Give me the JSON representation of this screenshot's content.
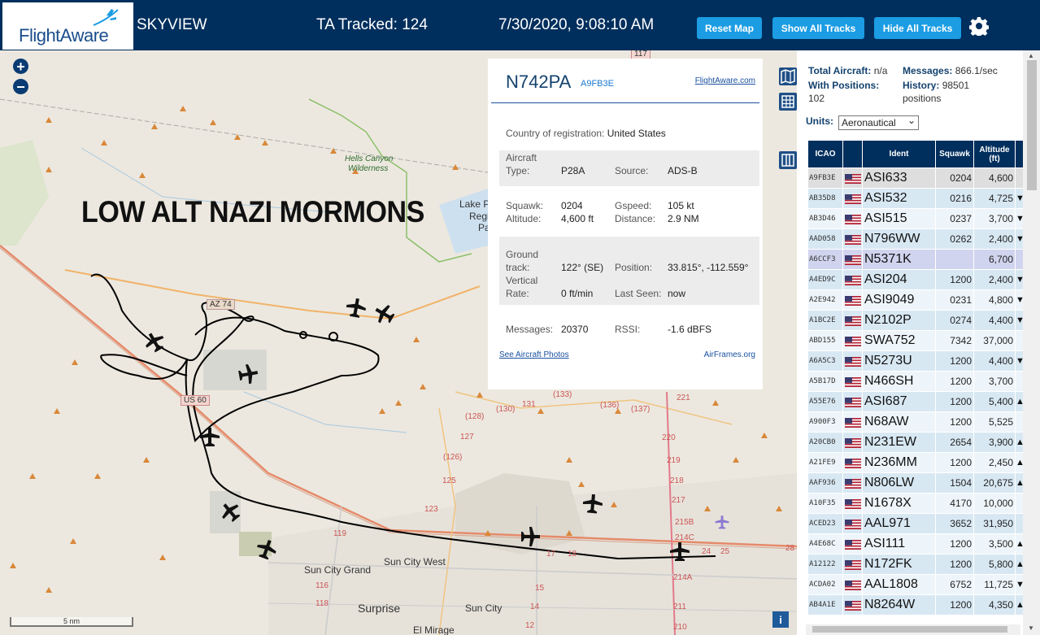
{
  "header": {
    "logo_text": "FlightAware",
    "app_title": "SKYVIEW",
    "ta_tracked": "TA Tracked: 124",
    "clock": "7/30/2020, 9:08:10 AM",
    "reset_map": "Reset Map",
    "show_all_tracks": "Show All Tracks",
    "hide_all_tracks": "Hide All Tracks",
    "settings_icon": "gear-icon",
    "brand_color": "#002f5d",
    "button_color": "#1b9ce3"
  },
  "map": {
    "zoom_in": "+",
    "zoom_out": "−",
    "overlay_text": "LOW ALT NAZI MORMONS",
    "scale": "5 nm",
    "info": "i",
    "labels": {
      "hells_canyon": "Hells Canyon",
      "wilderness": "Wilderness",
      "lake_p": "Lake P",
      "regi": "Regi",
      "pa": "Pa",
      "az74": "AZ 74",
      "us60": "US 60",
      "sun_city_grand": "Sun City Grand",
      "sun_city_west": "Sun City West",
      "sun_city": "Sun City",
      "surprise": "Surprise",
      "el_mirage": "El Mirage",
      "n117": "117",
      "n119": "119",
      "n116": "116",
      "n118": "118",
      "n123": "123",
      "n125": "125",
      "n126": "(126)",
      "n127": "127",
      "n128": "(128)",
      "n130": "(130)",
      "n131": "131",
      "n133": "(133)",
      "n136": "(136)",
      "n137": "(137)",
      "n220": "220",
      "n219": "219",
      "n218": "218",
      "n217": "217",
      "n215b": "215B",
      "n214c": "214C",
      "n214a": "214A",
      "n211": "211",
      "n210": "210",
      "n221": "221",
      "n24": "24",
      "n25": "25",
      "n28": "28",
      "n18": "18",
      "n14": "14",
      "n12": "12",
      "n17": "17",
      "n15": "15"
    }
  },
  "popup": {
    "callsign": "N742PA",
    "hex": "A9FB3E",
    "fa_link": "FlightAware.com",
    "country_label": "Country of registration:",
    "country_value": "United States",
    "aircraft_label": "Aircraft",
    "type_label": "Type:",
    "type_value": "P28A",
    "source_label": "Source:",
    "source_value": "ADS-B",
    "squawk_label": "Squawk:",
    "squawk_value": "0204",
    "gspeed_label": "Gspeed:",
    "gspeed_value": "105 kt",
    "altitude_label": "Altitude:",
    "altitude_value": "4,600 ft",
    "distance_label": "Distance:",
    "distance_value": "2.9 NM",
    "ground_label": "Ground",
    "track_label": "track:",
    "track_value": "122° (SE)",
    "position_label": "Position:",
    "position_value": "33.815°, -112.559°",
    "vertical_label": "Vertical",
    "rate_label": "Rate:",
    "rate_value": "0 ft/min",
    "lastseen_label": "Last Seen:",
    "lastseen_value": "now",
    "messages_label": "Messages:",
    "messages_value": "20370",
    "rssi_label": "RSSI:",
    "rssi_value": "-1.6 dBFS",
    "photos_link": "See Aircraft Photos",
    "airframes_link": "AirFrames.org"
  },
  "sidebar": {
    "total_label": "Total Aircraft:",
    "total_value": "n/a",
    "messages_label": "Messages:",
    "messages_value": "866.1/sec",
    "withpos_label": "With Positions:",
    "withpos_value": "102",
    "history_label": "History:",
    "history_value": "98501",
    "history_unit": "positions",
    "units_label": "Units:",
    "units_value": "Aeronautical",
    "columns": {
      "icao": "ICAO",
      "ident": "Ident",
      "squawk": "Squawk",
      "altitude": "Altitude (ft)"
    },
    "rows": [
      {
        "icao": "A9FB3E",
        "ident": "ASI633",
        "squawk": "0204",
        "alt": "4,600",
        "trend": ""
      },
      {
        "icao": "AB35D8",
        "ident": "ASI532",
        "squawk": "0216",
        "alt": "4,725",
        "trend": "▼"
      },
      {
        "icao": "AB3D46",
        "ident": "ASI515",
        "squawk": "0237",
        "alt": "3,700",
        "trend": "▼"
      },
      {
        "icao": "AAD058",
        "ident": "N796WW",
        "squawk": "0262",
        "alt": "2,400",
        "trend": "▼"
      },
      {
        "icao": "A6CCF3",
        "ident": "N5371K",
        "squawk": "",
        "alt": "6,700",
        "trend": ""
      },
      {
        "icao": "A4ED9C",
        "ident": "ASI204",
        "squawk": "1200",
        "alt": "2,400",
        "trend": "▼"
      },
      {
        "icao": "A2E942",
        "ident": "ASI9049",
        "squawk": "0231",
        "alt": "4,800",
        "trend": "▼"
      },
      {
        "icao": "A1BC2E",
        "ident": "N2102P",
        "squawk": "0274",
        "alt": "4,400",
        "trend": "▼"
      },
      {
        "icao": "ABD155",
        "ident": "SWA752",
        "squawk": "7342",
        "alt": "37,000",
        "trend": ""
      },
      {
        "icao": "A6A5C3",
        "ident": "N5273U",
        "squawk": "1200",
        "alt": "4,400",
        "trend": "▼"
      },
      {
        "icao": "A5B17D",
        "ident": "N466SH",
        "squawk": "1200",
        "alt": "3,700",
        "trend": ""
      },
      {
        "icao": "A55E76",
        "ident": "ASI687",
        "squawk": "1200",
        "alt": "5,400",
        "trend": "▲"
      },
      {
        "icao": "A900F3",
        "ident": "N68AW",
        "squawk": "1200",
        "alt": "5,525",
        "trend": ""
      },
      {
        "icao": "A20CB0",
        "ident": "N231EW",
        "squawk": "2654",
        "alt": "3,900",
        "trend": "▲"
      },
      {
        "icao": "A21FE9",
        "ident": "N236MM",
        "squawk": "1200",
        "alt": "2,450",
        "trend": "▲"
      },
      {
        "icao": "AAF936",
        "ident": "N806LW",
        "squawk": "1504",
        "alt": "20,675",
        "trend": "▲"
      },
      {
        "icao": "A10F35",
        "ident": "N1678X",
        "squawk": "4170",
        "alt": "10,000",
        "trend": ""
      },
      {
        "icao": "ACED23",
        "ident": "AAL971",
        "squawk": "3652",
        "alt": "31,950",
        "trend": ""
      },
      {
        "icao": "A4E68C",
        "ident": "ASI111",
        "squawk": "1200",
        "alt": "3,500",
        "trend": "▲"
      },
      {
        "icao": "A12122",
        "ident": "N172FK",
        "squawk": "1200",
        "alt": "5,800",
        "trend": "▲"
      },
      {
        "icao": "ACDA02",
        "ident": "AAL1808",
        "squawk": "6752",
        "alt": "11,725",
        "trend": "▼"
      },
      {
        "icao": "AB4A1E",
        "ident": "N8264W",
        "squawk": "1200",
        "alt": "4,350",
        "trend": "▲"
      }
    ]
  }
}
